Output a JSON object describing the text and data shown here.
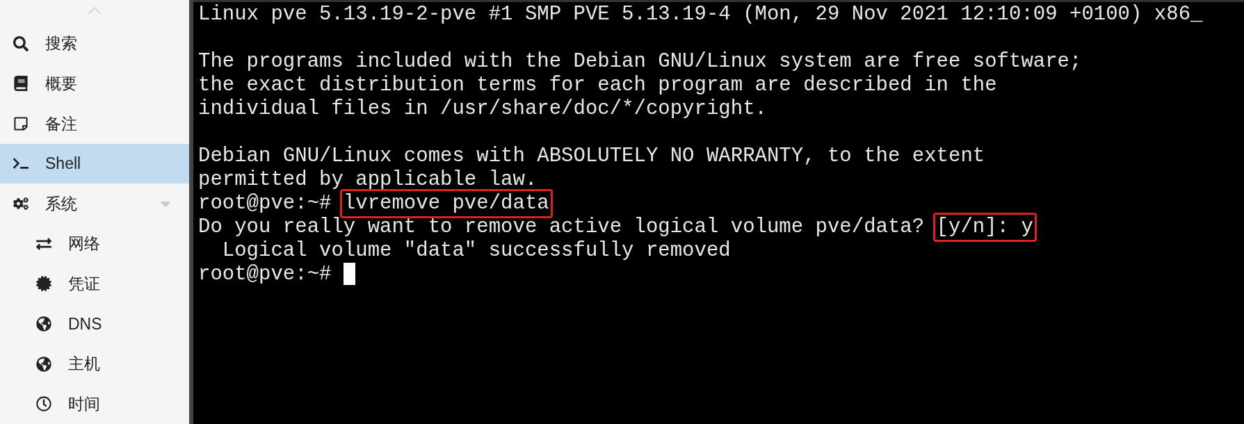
{
  "sidebar": {
    "items": [
      {
        "label": "搜索",
        "selected": false
      },
      {
        "label": "概要",
        "selected": false
      },
      {
        "label": "备注",
        "selected": false
      },
      {
        "label": "Shell",
        "selected": true
      },
      {
        "label": "系统",
        "selected": false,
        "expanded": true,
        "children": [
          {
            "label": "网络",
            "selected": false
          },
          {
            "label": "凭证",
            "selected": false
          },
          {
            "label": "DNS",
            "selected": false
          },
          {
            "label": "主机",
            "selected": false
          },
          {
            "label": "时间",
            "selected": false
          }
        ]
      }
    ]
  },
  "terminal": {
    "paragraphs": [
      [
        [
          {
            "text": "Linux pve 5.13.19-2-pve #1 SMP PVE 5.13.19-4 (Mon, 29 Nov 2021 12:10:09 +0100) x86_",
            "highlighted": false
          }
        ]
      ],
      [
        [
          {
            "text": "The programs included with the Debian GNU/Linux system are free software;",
            "highlighted": false
          }
        ],
        [
          {
            "text": "the exact distribution terms for each program are described in the",
            "highlighted": false
          }
        ],
        [
          {
            "text": "individual files in /usr/share/doc/*/copyright.",
            "highlighted": false
          }
        ]
      ],
      [
        [
          {
            "text": "Debian GNU/Linux comes with ABSOLUTELY NO WARRANTY, to the extent",
            "highlighted": false
          }
        ],
        [
          {
            "text": "permitted by applicable law.",
            "highlighted": false
          }
        ],
        [
          {
            "text": "root@pve:~# ",
            "highlighted": false
          },
          {
            "text": "lvremove pve/data",
            "highlighted": true
          }
        ],
        [
          {
            "text": "Do you really want to remove active logical volume pve/data? ",
            "highlighted": false
          },
          {
            "text": "[y/n]: y",
            "highlighted": true
          }
        ],
        [
          {
            "text": "  Logical volume \"data\" successfully removed",
            "highlighted": false
          }
        ],
        [
          {
            "text": "root@pve:~# ",
            "highlighted": false
          }
        ]
      ]
    ],
    "cursor": true
  }
}
